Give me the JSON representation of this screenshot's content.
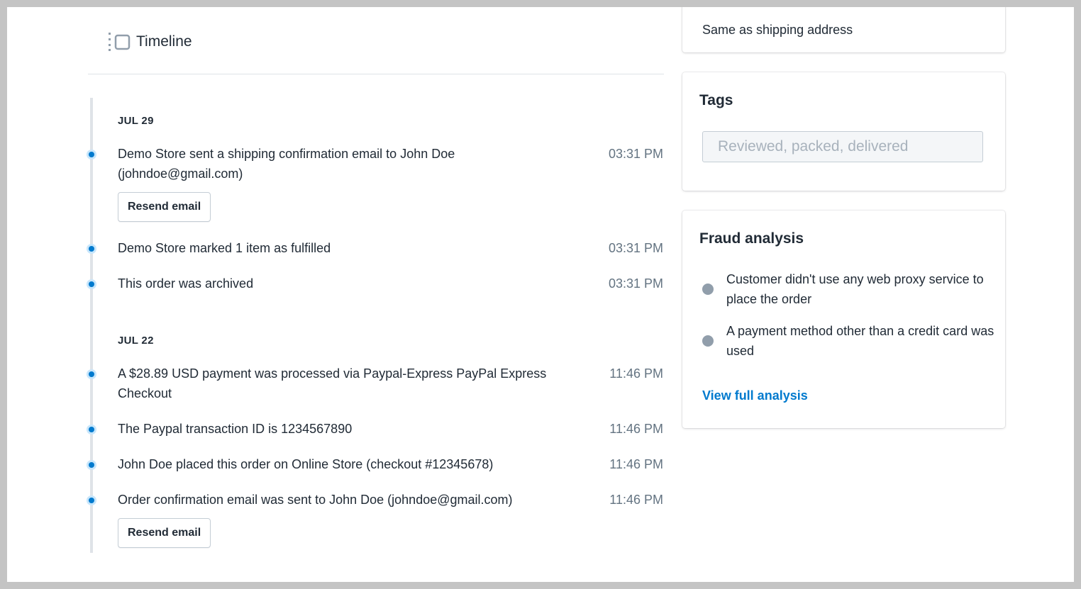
{
  "timeline": {
    "title": "Timeline",
    "groups": [
      {
        "date": "JUL 29",
        "events": [
          {
            "text": "Demo Store sent a shipping confirmation email to John Doe (johndoe@gmail.com)",
            "time": "03:31 PM",
            "action": "Resend email"
          },
          {
            "text": "Demo Store marked 1 item as fulfilled",
            "time": "03:31 PM"
          },
          {
            "text": "This order was archived",
            "time": "03:31 PM"
          }
        ]
      },
      {
        "date": "JUL 22",
        "events": [
          {
            "text": "A $28.89 USD payment was processed via Paypal-Express PayPal Express Checkout",
            "time": "11:46 PM"
          },
          {
            "text": "The Paypal transaction ID is 1234567890",
            "time": "11:46 PM"
          },
          {
            "text": "John Doe placed this order on Online Store (checkout #12345678)",
            "time": "11:46 PM"
          },
          {
            "text": "Order confirmation email was sent to John Doe (johndoe@gmail.com)",
            "time": "11:46 PM",
            "action": "Resend email"
          }
        ]
      }
    ]
  },
  "billing": {
    "text": "Same as shipping address"
  },
  "tags": {
    "title": "Tags",
    "placeholder": "Reviewed, packed, delivered"
  },
  "fraud": {
    "title": "Fraud analysis",
    "items": [
      {
        "text": "Customer didn't use any web proxy service to place the order"
      },
      {
        "text": "A payment method other than a credit card was used"
      }
    ],
    "link": "View full analysis"
  },
  "colors": {
    "accent": "#007ace",
    "text": "#212b36",
    "muted": "#637381",
    "neutral_dot": "#919eab"
  }
}
